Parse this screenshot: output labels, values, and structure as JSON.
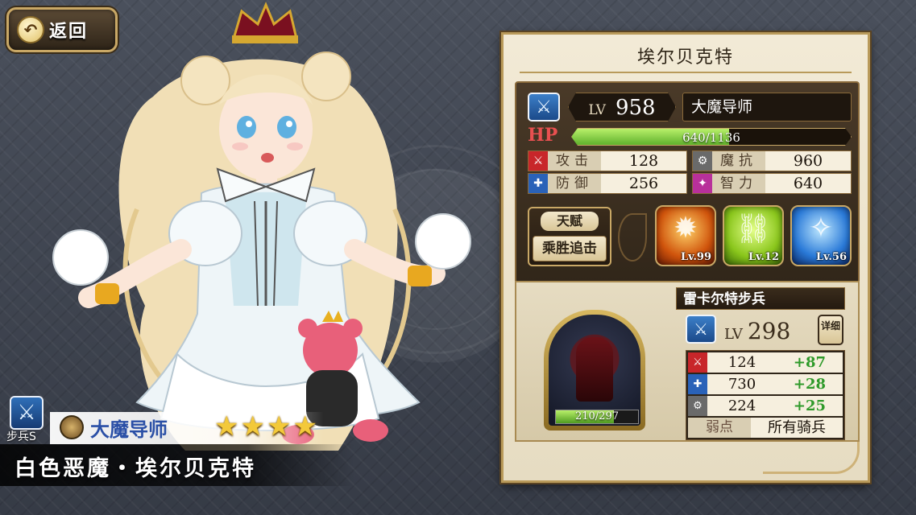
{
  "back_button": {
    "label": "返回",
    "icon": "back-arrow-icon"
  },
  "character": {
    "full_name": "白色恶魔・埃尔贝克特",
    "class_name": "大魔导师",
    "rarity_stars": 4,
    "unit_type_label": "步兵S",
    "unit_type_icon": "sword-icon"
  },
  "panel": {
    "title": "埃尔贝克特",
    "weapon_icon": "sword-icon",
    "lv_tag": "LV",
    "level": "958",
    "job": "大魔导师",
    "hp_tag": "HP",
    "hp_text": "640/1136",
    "hp_fraction": 0.563,
    "stats": [
      {
        "icon": "attack-icon",
        "name": "攻击",
        "value": "128"
      },
      {
        "icon": "magic-resist-icon",
        "name": "魔抗",
        "value": "960"
      },
      {
        "icon": "defense-icon",
        "name": "防御",
        "value": "256"
      },
      {
        "icon": "intelligence-icon",
        "name": "智力",
        "value": "640"
      }
    ],
    "talent_label": "天赋",
    "talent_name": "乘胜追击",
    "skills": [
      {
        "icon": "fire-skill-icon",
        "level": "Lv.99"
      },
      {
        "icon": "chain-skill-icon",
        "level": "Lv.12"
      },
      {
        "icon": "sparkle-skill-icon",
        "level": "Lv.56"
      }
    ]
  },
  "soldier": {
    "name": "雷卡尔特步兵",
    "weapon_icon": "sword-icon",
    "lv_tag": "LV",
    "level": "298",
    "detail_label": "详细",
    "troop_text": "210/297",
    "troop_fraction": 0.707,
    "stats": [
      {
        "icon": "attack-icon",
        "value": "124",
        "bonus": "+87"
      },
      {
        "icon": "defense-icon",
        "value": "730",
        "bonus": "+28"
      },
      {
        "icon": "magic-resist-icon",
        "value": "224",
        "bonus": "+25"
      }
    ],
    "weakness_label": "弱点",
    "weakness_value": "所有骑兵"
  },
  "colors": {
    "hp_green": "#5fb02c",
    "bonus_green": "#2f9a2a",
    "star_gold": "#f3c93a",
    "class_blue": "#2a4fa6",
    "panel_gold": "#b99a5a"
  }
}
